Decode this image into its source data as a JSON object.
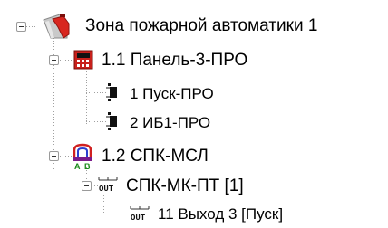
{
  "tree": {
    "root": {
      "label": "Зона пожарной автоматики 1",
      "icon": "fire-extinguisher-icon"
    },
    "panel": {
      "label": "1.1 Панель-3-ПРО",
      "icon": "control-panel-icon"
    },
    "panel_children": [
      {
        "label": "1 Пуск-ПРО",
        "icon": "device-icon"
      },
      {
        "label": "2 ИБ1-ПРО",
        "icon": "device-icon"
      }
    ],
    "spk_msl": {
      "label": "1.2 СПК-МСЛ",
      "icon": "ab-module-icon"
    },
    "spk_mk": {
      "label": "СПК-МК-ПТ [1]",
      "icon": "out-module-icon",
      "icon_text": "OUT"
    },
    "output": {
      "label": "11 Выход 3 [Пуск]",
      "icon": "out-module-icon",
      "icon_text": "OUT"
    }
  }
}
